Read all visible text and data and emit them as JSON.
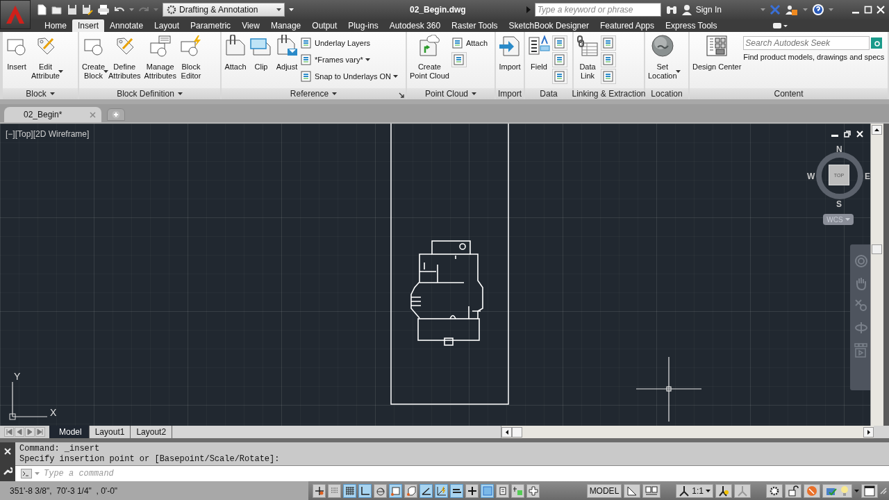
{
  "title_bar": {
    "workspace": "Drafting & Annotation",
    "title": "02_Begin.dwg",
    "search_placeholder": "Type a keyword or phrase",
    "sign_in": "Sign In"
  },
  "ribbon_tabs": [
    {
      "label": "Home",
      "selected": false
    },
    {
      "label": "Insert",
      "selected": true
    },
    {
      "label": "Annotate",
      "selected": false
    },
    {
      "label": "Layout",
      "selected": false
    },
    {
      "label": "Parametric",
      "selected": false
    },
    {
      "label": "View",
      "selected": false
    },
    {
      "label": "Manage",
      "selected": false
    },
    {
      "label": "Output",
      "selected": false
    },
    {
      "label": "Plug-ins",
      "selected": false
    },
    {
      "label": "Autodesk 360",
      "selected": false
    },
    {
      "label": "Raster Tools",
      "selected": false
    },
    {
      "label": "SketchBook Designer",
      "selected": false
    },
    {
      "label": "Featured Apps",
      "selected": false
    },
    {
      "label": "Express Tools",
      "selected": false
    }
  ],
  "ribbon_panels": [
    {
      "title": "Block",
      "has_menu": true,
      "launcher": false,
      "items": [
        {
          "kind": "large",
          "label": "Insert",
          "dropdown": false
        },
        {
          "kind": "large",
          "label": "Edit\nAttribute",
          "dropdown": true
        }
      ]
    },
    {
      "title": "Block Definition",
      "has_menu": true,
      "launcher": false,
      "items": [
        {
          "kind": "large",
          "label": "Create\nBlock",
          "dropdown": true
        },
        {
          "kind": "large",
          "label": "Define\nAttributes",
          "dropdown": false
        },
        {
          "kind": "large",
          "label": "Manage\nAttributes",
          "dropdown": false
        },
        {
          "kind": "large",
          "label": "Block\nEditor",
          "dropdown": false
        }
      ]
    },
    {
      "title": "Reference",
      "has_menu": true,
      "launcher": true,
      "items": [
        {
          "kind": "large",
          "label": "Attach",
          "dropdown": false
        },
        {
          "kind": "large",
          "label": "Clip",
          "dropdown": false
        },
        {
          "kind": "large",
          "label": "Adjust",
          "dropdown": false
        },
        {
          "kind": "small",
          "label": "Underlay Layers",
          "dropdown": false
        },
        {
          "kind": "small",
          "label": "*Frames vary*",
          "dropdown": true
        },
        {
          "kind": "small",
          "label": "Snap to Underlays ON",
          "dropdown": true
        }
      ]
    },
    {
      "title": "Point Cloud",
      "has_menu": true,
      "launcher": false,
      "items": [
        {
          "kind": "large",
          "label": "Create\nPoint Cloud",
          "dropdown": false
        },
        {
          "kind": "small",
          "label": "Attach",
          "dropdown": false
        },
        {
          "kind": "icon"
        }
      ]
    },
    {
      "title": "Import",
      "has_menu": false,
      "launcher": false,
      "items": [
        {
          "kind": "large",
          "label": "Import",
          "dropdown": false
        }
      ]
    },
    {
      "title": "Data",
      "has_menu": false,
      "launcher": false,
      "items": [
        {
          "kind": "large",
          "label": "Field",
          "dropdown": false
        },
        {
          "kind": "icon"
        },
        {
          "kind": "icon"
        },
        {
          "kind": "icon"
        }
      ]
    },
    {
      "title": "Linking & Extraction",
      "has_menu": false,
      "launcher": false,
      "items": [
        {
          "kind": "large",
          "label": "Data\nLink",
          "dropdown": false
        },
        {
          "kind": "icon"
        },
        {
          "kind": "icon"
        },
        {
          "kind": "icon"
        }
      ]
    },
    {
      "title": "Location",
      "has_menu": false,
      "launcher": false,
      "items": [
        {
          "kind": "large",
          "label": "Set\nLocation",
          "dropdown": true
        }
      ]
    },
    {
      "title": "Content",
      "has_menu": false,
      "launcher": false,
      "items": [
        {
          "kind": "large",
          "label": "Design Center",
          "dropdown": false
        },
        {
          "kind": "search",
          "placeholder": "Search Autodesk Seek",
          "caption": "Find product models, drawings and specs"
        }
      ]
    }
  ],
  "file_tabs": [
    {
      "label": "02_Begin*",
      "selected": true
    }
  ],
  "viewport": {
    "label": "[−][Top][2D Wireframe]",
    "compass": {
      "north": "N",
      "east": "E",
      "south": "S",
      "west": "W",
      "face": "TOP"
    },
    "ucs_menu": "WCS",
    "ucs_axes": {
      "x": "X",
      "y": "Y"
    }
  },
  "layout_tabs": [
    {
      "kind": "model",
      "label": "Model",
      "selected": true
    },
    {
      "kind": "layout",
      "label": "Layout1",
      "selected": false
    },
    {
      "kind": "layout",
      "label": "Layout2",
      "selected": false
    }
  ],
  "command": {
    "history": [
      "Command: _insert",
      "Specify insertion point or [Basepoint/Scale/Rotate]:"
    ],
    "placeholder": "Type a command"
  },
  "status_bar": {
    "coordinates": "351'-8 3/8\",  70'-3 1/4\"  , 0'-0\"",
    "toggles": [
      {
        "on": false
      },
      {
        "on": false
      },
      {
        "on": true
      },
      {
        "on": true
      },
      {
        "on": false
      },
      {
        "on": true
      },
      {
        "on": false
      },
      {
        "on": true
      },
      {
        "on": true
      },
      {
        "on": true
      },
      {
        "on": false
      },
      {
        "on": true
      },
      {
        "on": false
      },
      {
        "on": false
      },
      {
        "on": false
      }
    ],
    "space": "MODEL",
    "annotation_scale": "1:1"
  }
}
